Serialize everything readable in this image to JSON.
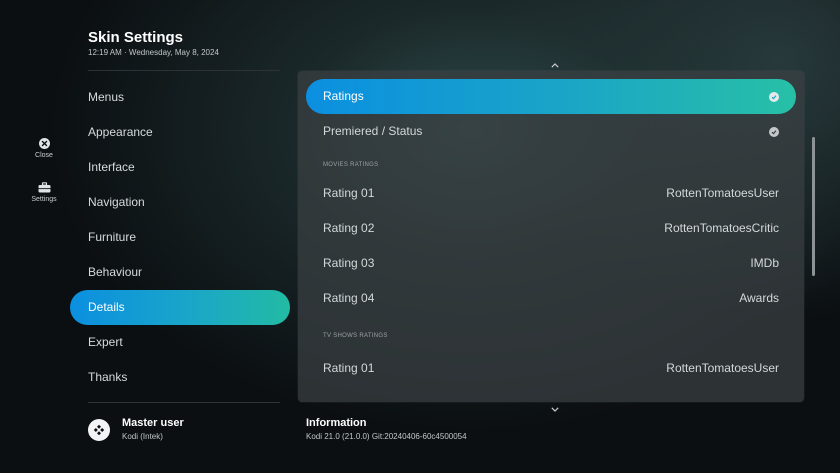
{
  "header": {
    "title": "Skin Settings",
    "subtitle": "12:19 AM · Wednesday, May 8, 2024"
  },
  "rail": {
    "close_label": "Close",
    "settings_label": "Settings"
  },
  "menu": {
    "items": [
      {
        "label": "Menus"
      },
      {
        "label": "Appearance"
      },
      {
        "label": "Interface"
      },
      {
        "label": "Navigation"
      },
      {
        "label": "Furniture"
      },
      {
        "label": "Behaviour"
      },
      {
        "label": "Details",
        "active": true
      },
      {
        "label": "Expert"
      },
      {
        "label": "Thanks"
      }
    ]
  },
  "panel": {
    "toggles": [
      {
        "label": "Ratings",
        "checked": true,
        "active": true
      },
      {
        "label": "Premiered / Status",
        "checked": true
      }
    ],
    "movies_header": "MOVIES RATINGS",
    "movies": [
      {
        "label": "Rating 01",
        "value": "RottenTomatoesUser"
      },
      {
        "label": "Rating 02",
        "value": "RottenTomatoesCritic"
      },
      {
        "label": "Rating 03",
        "value": "IMDb"
      },
      {
        "label": "Rating 04",
        "value": "Awards"
      }
    ],
    "tv_header": "TV SHOWS RATINGS",
    "tv": [
      {
        "label": "Rating 01",
        "value": "RottenTomatoesUser"
      }
    ]
  },
  "footer": {
    "user_name": "Master user",
    "user_sub": "Kodi (Intek)",
    "info_title": "Information",
    "info_sub": "Kodi 21.0 (21.0.0) Git:20240406-60c4500054"
  },
  "colors": {
    "accent_start": "#0b8fe0",
    "accent_end": "#22bba4"
  }
}
